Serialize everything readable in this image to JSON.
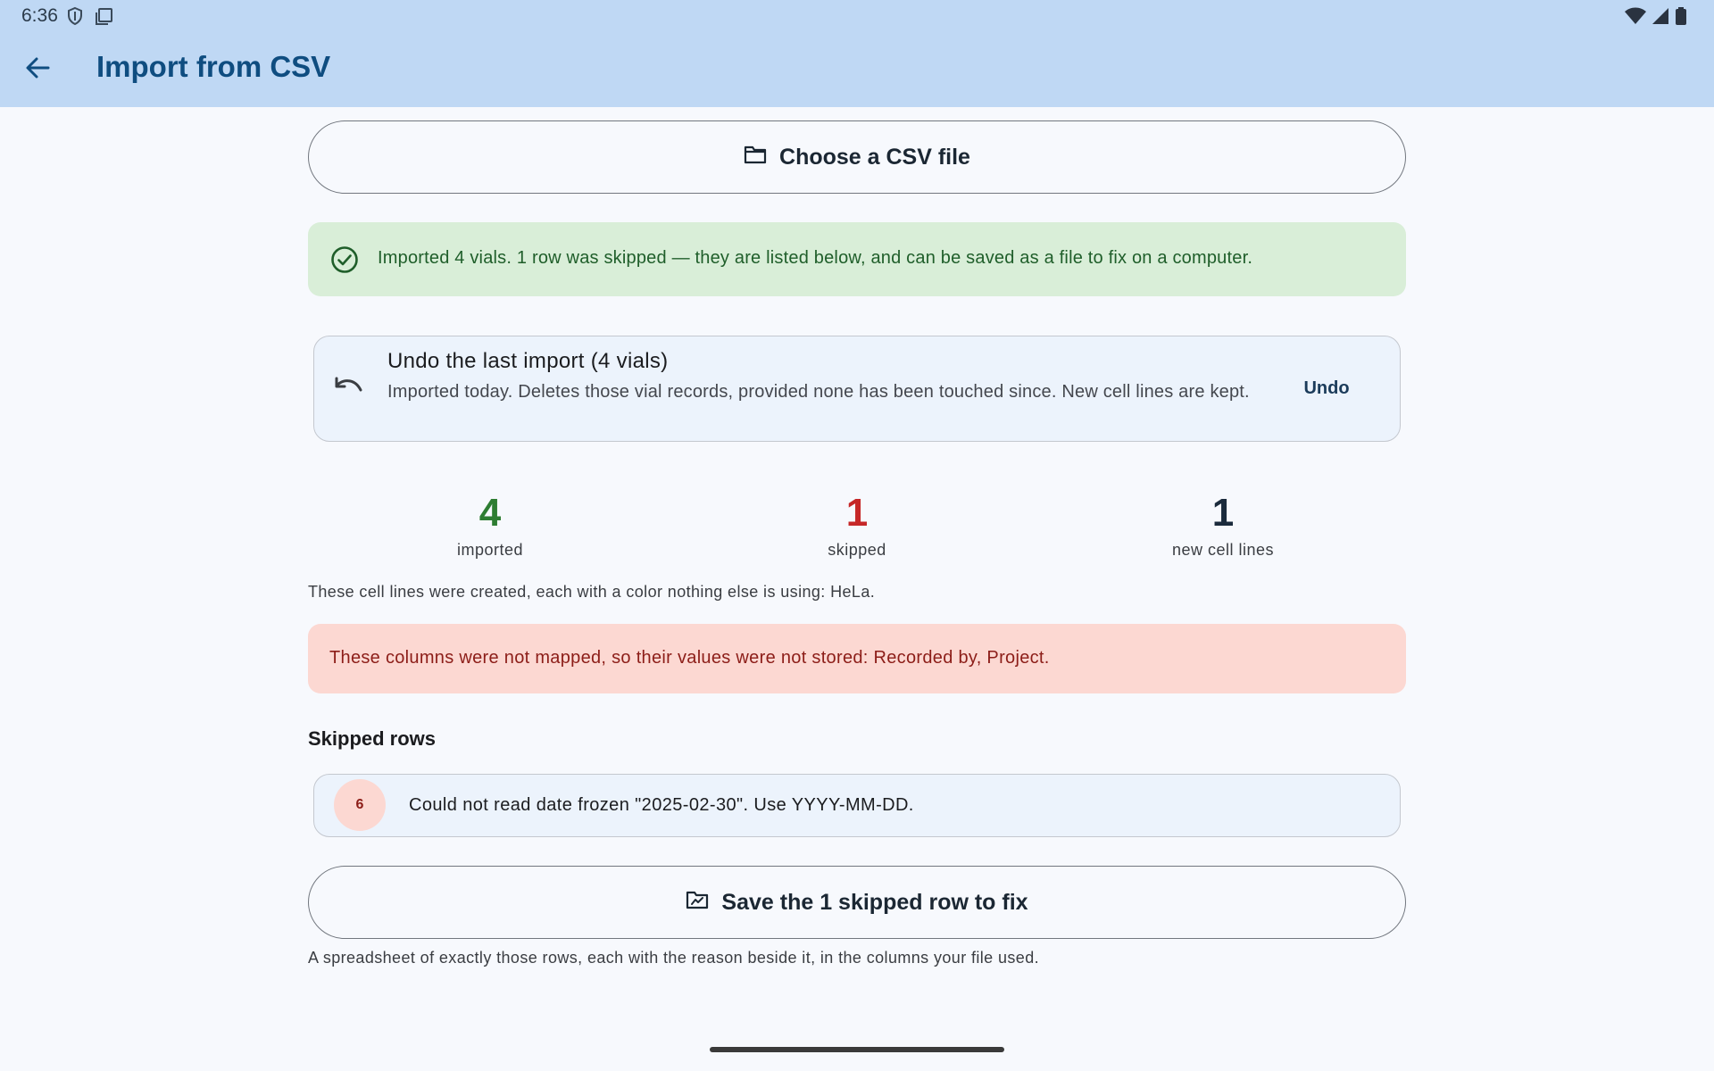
{
  "status_bar": {
    "time": "6:36",
    "left_icons": [
      "shield-icon",
      "screenshot-icon"
    ],
    "right_icons": [
      "wifi-icon",
      "signal-icon",
      "battery-icon"
    ]
  },
  "app_bar": {
    "title": "Import from CSV",
    "back_icon": "arrow-back-icon"
  },
  "choose_file": {
    "label": "Choose a CSV file",
    "icon": "folder-icon"
  },
  "success_banner": {
    "icon": "check-circle-icon",
    "text": "Imported 4 vials. 1 row was skipped — they are listed below, and can be saved as a file to fix on a computer."
  },
  "undo_card": {
    "icon": "undo-icon",
    "title": "Undo the last import (4 vials)",
    "description": "Imported today. Deletes those vial records, provided none has been touched since. New cell lines are kept.",
    "action_label": "Undo"
  },
  "stats": [
    {
      "value": "4",
      "label": "imported",
      "color": "#2e7d32"
    },
    {
      "value": "1",
      "label": "skipped",
      "color": "#c62828"
    },
    {
      "value": "1",
      "label": "new cell lines",
      "color": "#1b2b3c"
    }
  ],
  "created_note": "These cell lines were created, each with a color nothing else is using: HeLa.",
  "unmapped_banner": {
    "text": "These columns were not mapped, so their values were not stored: Recorded by, Project."
  },
  "skipped_section": {
    "title": "Skipped rows",
    "rows": [
      {
        "row_number": "6",
        "reason": "Could not read date frozen \"2025-02-30\". Use YYYY-MM-DD."
      }
    ]
  },
  "save_button": {
    "label": "Save the 1 skipped row to fix",
    "icon": "folder-open-icon"
  },
  "footer_note": "A spreadsheet of exactly those rows, each with the reason beside it, in the columns your file used.",
  "colors": {
    "app_bar": "#bfd8f4",
    "title": "#0f4d80",
    "success_bg": "#d9eed8",
    "success_text": "#1f5e2a",
    "warn_bg": "#fcd8d2",
    "warn_text": "#8c1d18"
  }
}
